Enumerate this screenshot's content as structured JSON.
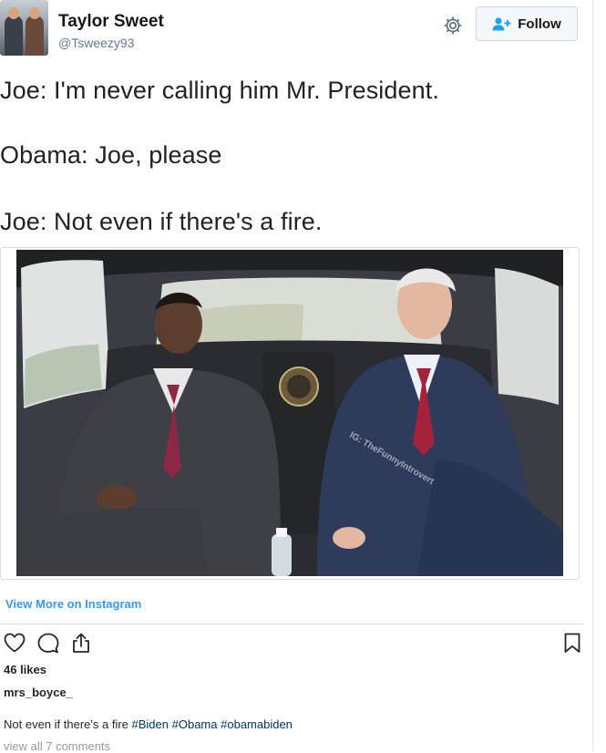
{
  "tweet": {
    "author": {
      "name": "Taylor Sweet",
      "handle": "@Tsweezy93"
    },
    "follow_label": "Follow",
    "lines": [
      "Joe: I'm never calling him Mr. President.",
      "Obama: Joe, please",
      "Joe: Not even if there's a fire."
    ]
  },
  "instagram": {
    "watermark": "IG: TheFunnyIntrovert",
    "view_more": "View More on Instagram",
    "likes": "46 likes",
    "username": "mrs_boyce_",
    "caption": {
      "text": "Not even if there's a fire",
      "hashtags": [
        "#Biden",
        "#Obama",
        "#obamabiden"
      ]
    },
    "view_comments": "view all 7 comments"
  },
  "icons": {
    "settings": "gear-icon",
    "follow": "add-user-icon",
    "like": "heart-icon",
    "comment": "comment-icon",
    "share": "share-icon",
    "save": "bookmark-icon"
  },
  "colors": {
    "twitter_text": "#14171a",
    "handle_gray": "#657786",
    "instagram_link": "#3897f0",
    "hashtag": "#003569",
    "muted": "#999999"
  }
}
